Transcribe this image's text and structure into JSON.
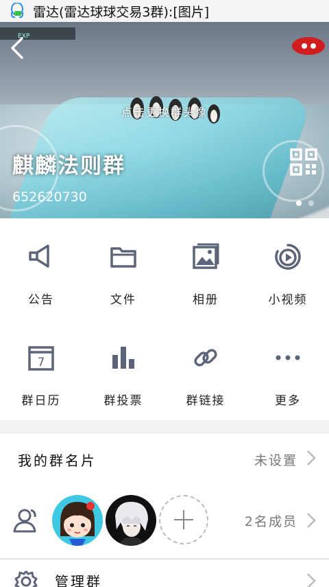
{
  "status_bar": {
    "notification_text": "雷达(雷达球球交易3群):[图片]"
  },
  "banner": {
    "upload_hint": "点击更换群头像",
    "group_name": "麒麟法则群",
    "group_id": "652620730",
    "page_indicator": {
      "count": 2,
      "active_index": 0
    }
  },
  "features": [
    {
      "label": "公告",
      "icon": "megaphone-icon"
    },
    {
      "label": "文件",
      "icon": "folder-icon"
    },
    {
      "label": "相册",
      "icon": "photo-album-icon"
    },
    {
      "label": "小视频",
      "icon": "video-play-icon"
    },
    {
      "label": "群日历",
      "icon": "calendar-icon"
    },
    {
      "label": "群投票",
      "icon": "bar-chart-icon"
    },
    {
      "label": "群链接",
      "icon": "link-icon"
    },
    {
      "label": "更多",
      "icon": "more-dots-icon"
    }
  ],
  "calendar_day": "7",
  "group_card": {
    "label": "我的群名片",
    "value": "未设置"
  },
  "members": {
    "count_text": "2名成员"
  },
  "admin": {
    "label": "管理群"
  },
  "colors": {
    "icon": "#5b6478",
    "text": "#222222",
    "secondary": "#777777"
  }
}
